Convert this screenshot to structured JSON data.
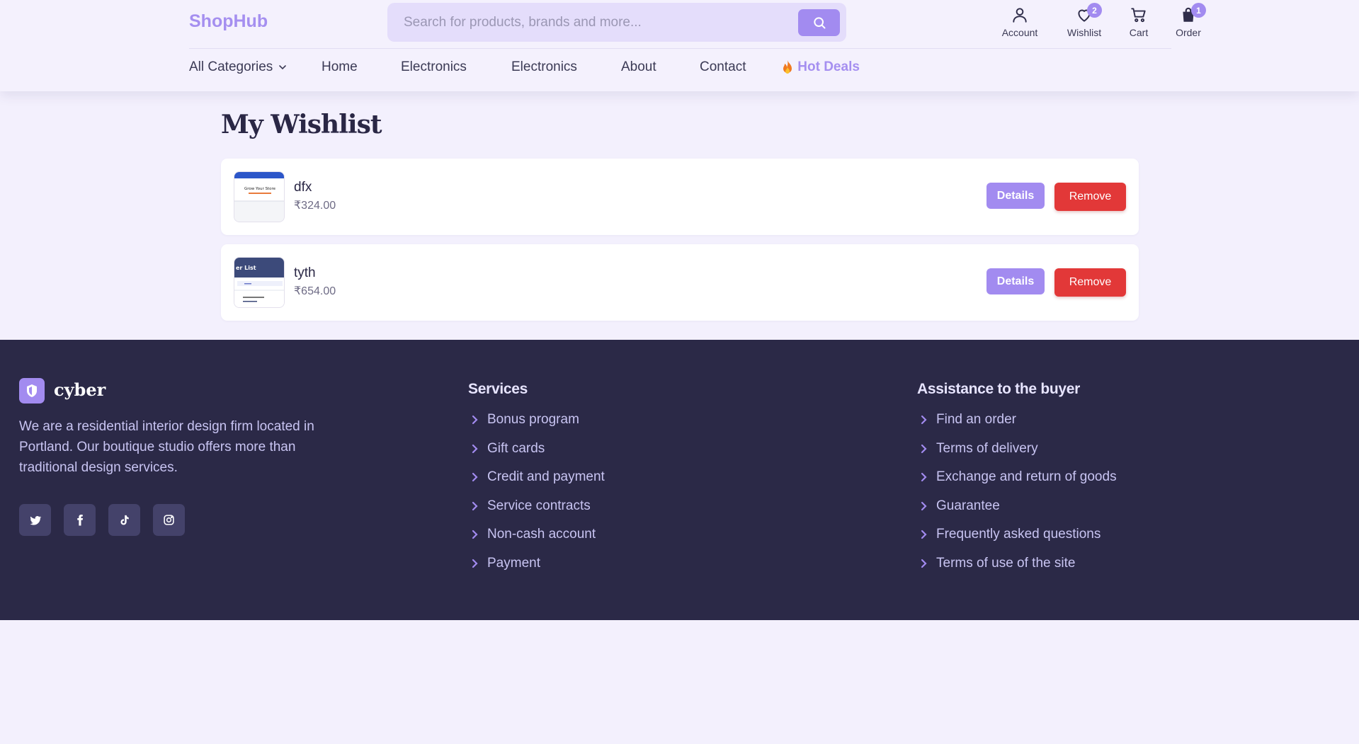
{
  "header": {
    "logo": "ShopHub",
    "search_placeholder": "Search for products, brands and more...",
    "icons": [
      {
        "label": "Account",
        "icon": "user-icon"
      },
      {
        "label": "Wishlist",
        "icon": "heart-icon",
        "badge": "2"
      },
      {
        "label": "Cart",
        "icon": "cart-icon"
      },
      {
        "label": "Order",
        "icon": "bag-icon",
        "badge": "1"
      }
    ],
    "nav": [
      "All Categories",
      "Home",
      "Electronics",
      "Electronics",
      "About",
      "Contact",
      "Hot Deals"
    ]
  },
  "main": {
    "title": "My Wishlist",
    "items": [
      {
        "name": "dfx",
        "price": "₹324.00",
        "thumb_caption": "Grow Your Store"
      },
      {
        "name": "tyth",
        "price": "₹654.00",
        "thumb_caption": "er List"
      }
    ],
    "details_label": "Details",
    "remove_label": "Remove"
  },
  "footer": {
    "brand": "cyber",
    "description": "We are a residential interior design firm located in Portland. Our boutique studio offers more than traditional design services.",
    "social": [
      "twitter-icon",
      "facebook-icon",
      "tiktok-icon",
      "instagram-icon"
    ],
    "services": {
      "title": "Services",
      "links": [
        "Bonus program",
        "Gift cards",
        "Credit and payment",
        "Service contracts",
        "Non-cash account",
        "Payment"
      ]
    },
    "assistance": {
      "title": "Assistance to the buyer",
      "links": [
        "Find an order",
        "Terms of delivery",
        "Exchange and return of goods",
        "Guarantee",
        "Frequently asked questions",
        "Terms of use of the site"
      ]
    }
  },
  "colors": {
    "accent": "#a28bf0",
    "danger": "#e23838",
    "footer_bg": "#2b2947",
    "page_bg": "#f3f0fd"
  }
}
